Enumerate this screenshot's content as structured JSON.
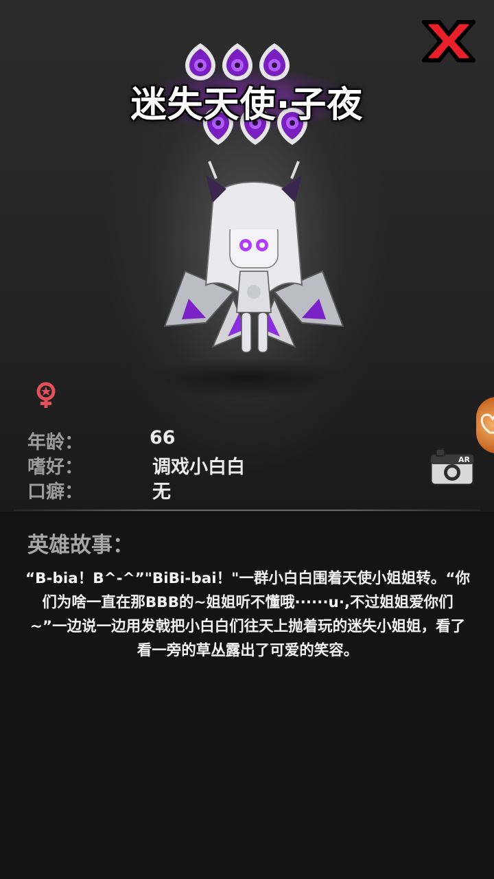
{
  "hero": {
    "name": "迷失天使·子夜",
    "star_count": 6
  },
  "attributes": {
    "age_label": "年龄：",
    "age_value": "66",
    "hobby_label": "嗜好：",
    "hobby_value": "调戏小白白",
    "catchphrase_label": "口癖：",
    "catchphrase_value": "无"
  },
  "ar_button": {
    "label": "AR"
  },
  "story": {
    "heading": "英雄故事：",
    "text": "“B-bia！B^-^”\"BiBi-bai！\"一群小白白围着天使小姐姐转。“你们为啥一直在那BBB的~姐姐听不懂哦······u·,不过姐姐爱你们~”一边说一边用发戟把小白白们往天上抛着玩的迷失小姐姐，看了看一旁的草丛露出了可爱的笑容。"
  },
  "icons": {
    "close": "close-x-icon",
    "gender": "female-icon",
    "ar": "ar-camera-icon",
    "side_tab": "heart-tab-icon"
  },
  "colors": {
    "background": "#141414",
    "star_purple": "#8a2bd0",
    "close_red": "#d0101a",
    "gender_pink": "#e2505a",
    "side_tab_orange": "#d8803a"
  }
}
